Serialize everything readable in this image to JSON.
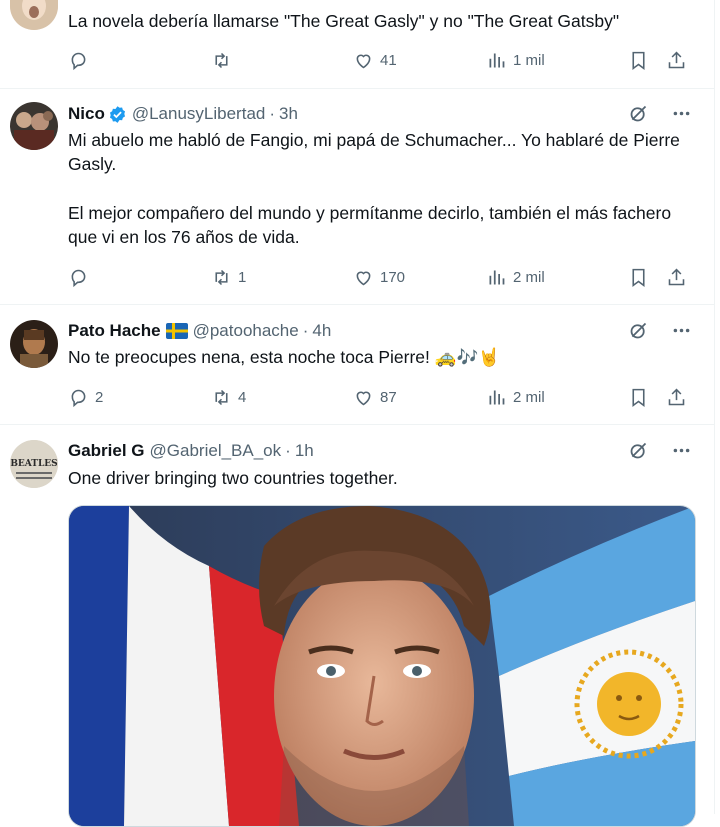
{
  "tweets": [
    {
      "text": "La novela debería llamarse \"The Great Gasly\" y no \"The Great Gatsby\"",
      "replies": "",
      "retweets": "",
      "likes": "41",
      "views": "1 mil"
    },
    {
      "name": "Nico",
      "handle": "@LanusyLibertad",
      "dot": "·",
      "time": "3h",
      "text1": "Mi abuelo me habló de Fangio, mi papá de Schumacher... Yo hablaré de Pierre Gasly.",
      "text2": "El mejor compañero del mundo y permítanme decirlo, también el más fachero que vi en los 76 años de vida.",
      "replies": "",
      "retweets": "1",
      "likes": "170",
      "views": "2 mil"
    },
    {
      "name": "Pato Hache",
      "handle": "@patoohache",
      "dot": "·",
      "time": "4h",
      "text": "No te preocupes nena, esta noche toca Pierre! 🚕🎶🤘",
      "replies": "2",
      "retweets": "4",
      "likes": "87",
      "views": "2 mil"
    },
    {
      "name": "Gabriel G",
      "handle": "@Gabriel_BA_ok",
      "dot": "·",
      "time": "1h",
      "text": "One driver bringing two countries together.",
      "avatar_text": "BEATLES"
    }
  ],
  "colors": {
    "text": "#0f1419",
    "muted": "#536471",
    "verified": "#1d9bf0",
    "divider": "#eff3f4"
  }
}
